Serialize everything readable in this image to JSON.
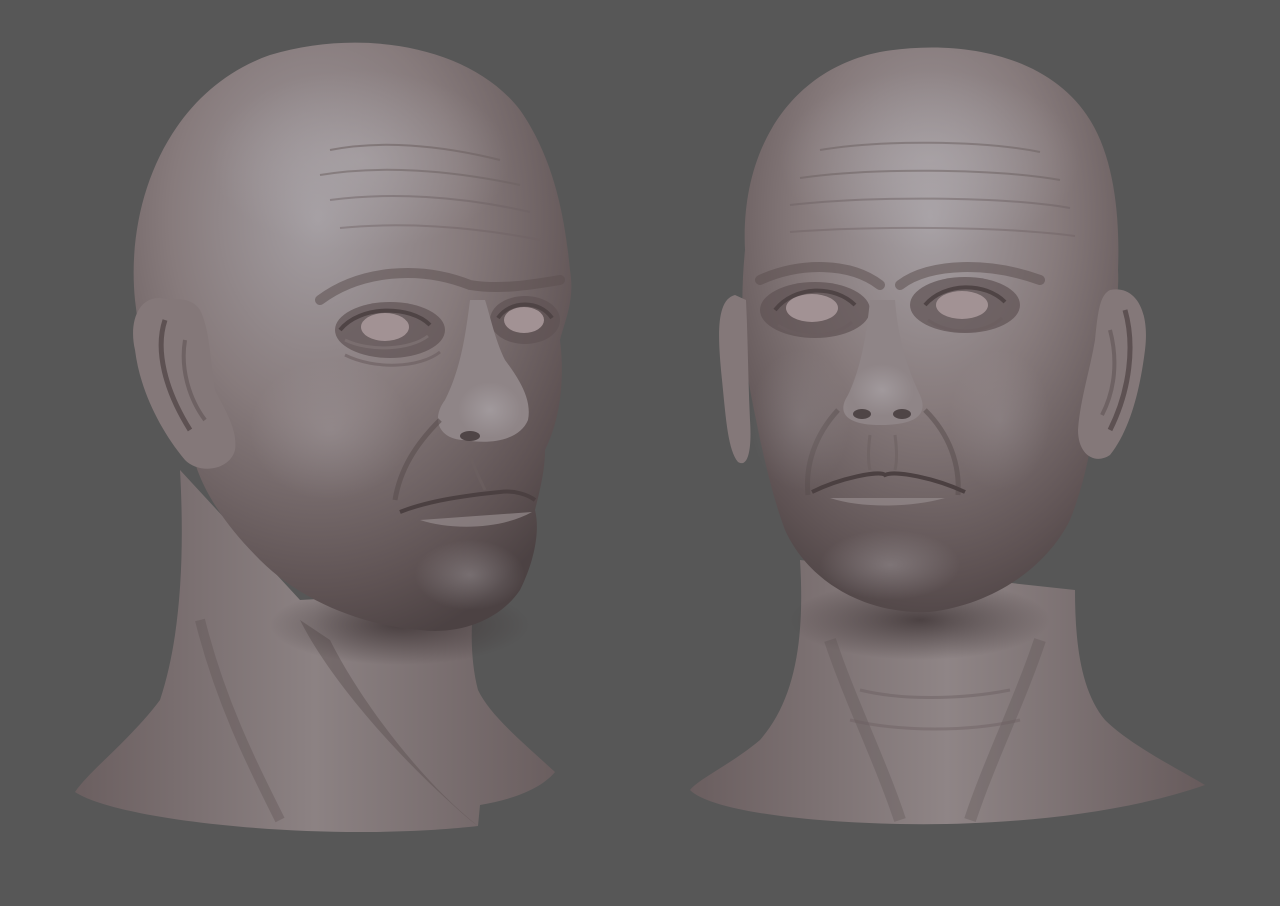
{
  "scene": {
    "background_color": "#575757",
    "material_color": "#7d7272",
    "material_highlight": "#a59fa2",
    "material_shadow": "#4a3f3f",
    "models": [
      {
        "view": "three-quarter",
        "icon": "sculpt-head-three-quarter"
      },
      {
        "view": "front",
        "icon": "sculpt-head-front"
      }
    ]
  }
}
